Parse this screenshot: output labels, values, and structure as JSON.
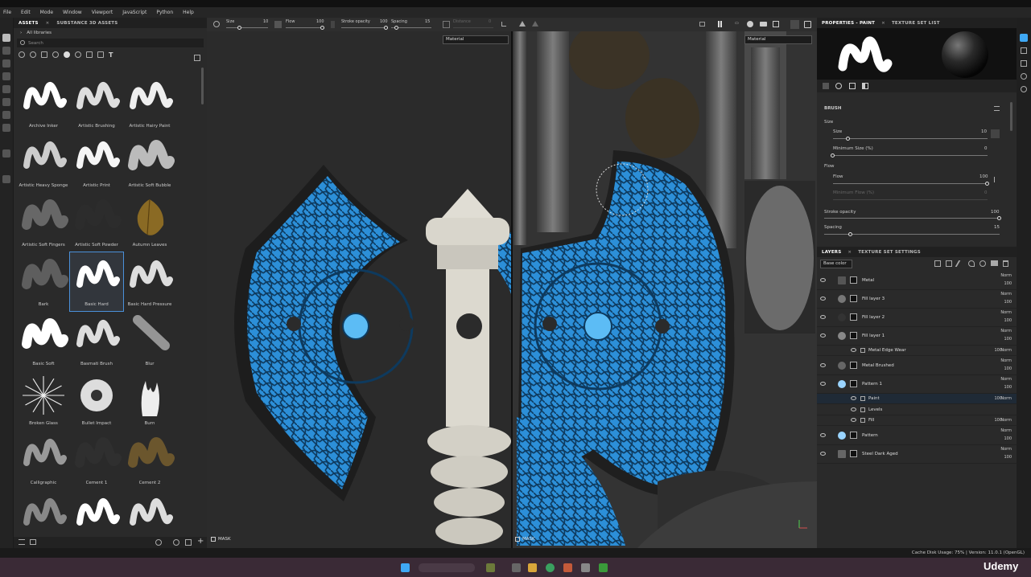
{
  "menu": [
    "File",
    "Edit",
    "Mode",
    "Window",
    "Viewport",
    "JavaScript",
    "Python",
    "Help"
  ],
  "assets": {
    "tabs": [
      "ASSETS",
      "SUBSTANCE 3D ASSETS"
    ],
    "library": "All libraries",
    "search_placeholder": "Search",
    "items": [
      "Archive Inker",
      "Artistic Brushing",
      "Artistic Hairy Paint",
      "Artistic Heavy Sponge",
      "Artistic Print",
      "Artistic Soft Bubble",
      "Artistic Soft Fingers",
      "Artistic Soft Powder",
      "Autumn Leaves",
      "Bark",
      "Basic Hard",
      "Basic Hard Pressure",
      "Basic Soft",
      "Basmati Brush",
      "Blur",
      "Broken Glass",
      "Bullet Impact",
      "Burn",
      "Calligraphic",
      "Cement 1",
      "Cement 2",
      "",
      "",
      ""
    ],
    "selected": "Basic Hard"
  },
  "toolbar": {
    "size_label": "Size",
    "size_value": "10",
    "flow_label": "Flow",
    "flow_value": "100",
    "opacity_label": "Stroke opacity",
    "opacity_value": "100",
    "spacing_label": "Spacing",
    "spacing_value": "15",
    "distance_label": "Distance",
    "distance_value": "0"
  },
  "viewport": {
    "left_dropdown": "Material",
    "right_dropdown": "Material",
    "mask_left": "MASK",
    "mask_right": "MASK"
  },
  "properties": {
    "tabs": [
      "PROPERTIES - PAINT",
      "TEXTURE SET LIST"
    ],
    "brush_header": "BRUSH",
    "size_group": "Size",
    "size_label": "Size",
    "size_value": "10",
    "size_level": 0.1,
    "min_size_label": "Minimum Size (%)",
    "min_size_value": "0",
    "min_size_level": 0,
    "flow_group": "Flow",
    "flow_label": "Flow",
    "flow_value": "100",
    "flow_level": 1.0,
    "min_flow_label": "Minimum Flow (%)",
    "min_flow_value": "0",
    "opacity_label": "Stroke opacity",
    "opacity_value": "100",
    "opacity_level": 1.0,
    "spacing_label": "Spacing",
    "spacing_value": "15",
    "spacing_level": 0.15
  },
  "layers": {
    "tabs": [
      "LAYERS",
      "TEXTURE SET SETTINGS"
    ],
    "channel": "Base color",
    "items": [
      {
        "name": "Metal",
        "blend": "Norm",
        "opacity": "100",
        "thumb": "#555"
      },
      {
        "name": "Fill layer 3",
        "blend": "Norm",
        "opacity": "100",
        "thumb": "#777"
      },
      {
        "name": "Fill layer 2",
        "blend": "Norm",
        "opacity": "100",
        "thumb": "#333"
      },
      {
        "name": "Fill layer 1",
        "blend": "Norm",
        "opacity": "100",
        "thumb": "#888"
      },
      {
        "name": "Metal Edge Wear",
        "blend": "Norm",
        "opacity": "100",
        "thumb": ""
      },
      {
        "name": "Metal Brushed",
        "blend": "Norm",
        "opacity": "100",
        "thumb": "#666"
      },
      {
        "name": "Pattern 1",
        "blend": "Norm",
        "opacity": "100",
        "thumb": "#9ad4ff"
      },
      {
        "name": "Paint",
        "blend": "Norm",
        "opacity": "100",
        "thumb": ""
      },
      {
        "name": "Levels",
        "blend": "",
        "opacity": "",
        "thumb": ""
      },
      {
        "name": "Fill",
        "blend": "Norm",
        "opacity": "100",
        "thumb": ""
      },
      {
        "name": "Pattern",
        "blend": "Norm",
        "opacity": "100",
        "thumb": "#9ad4ff"
      },
      {
        "name": "Steel Dark Aged",
        "blend": "Norm",
        "opacity": "100",
        "thumb": "#666"
      }
    ]
  },
  "status": {
    "text": "Cache Disk Usage:  75% | Version: 11.0.1 (OpenGL)"
  },
  "watermark": "Udemy",
  "colors": {
    "accent": "#3fa9f5",
    "rune_blue": "#3aa0e8",
    "panel": "#2a2a2a"
  }
}
